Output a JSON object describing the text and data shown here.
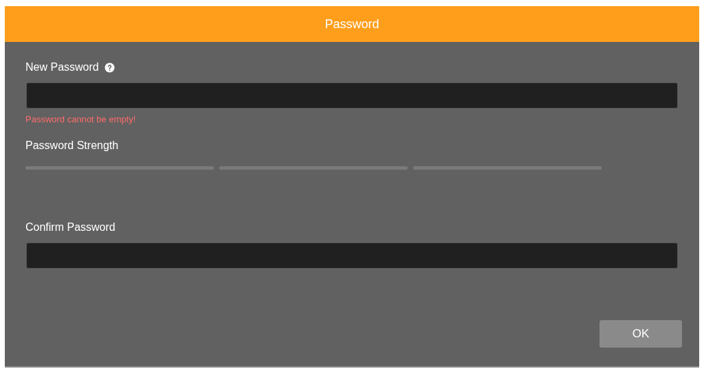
{
  "dialog": {
    "title": "Password"
  },
  "new_password": {
    "label": "New Password",
    "error": "Password cannot be empty!"
  },
  "strength": {
    "label": "Password Strength",
    "segments": [
      {
        "on": false
      },
      {
        "on": false
      },
      {
        "on": false
      }
    ]
  },
  "confirm_password": {
    "label": "Confirm Password"
  },
  "buttons": [
    "OK"
  ]
}
